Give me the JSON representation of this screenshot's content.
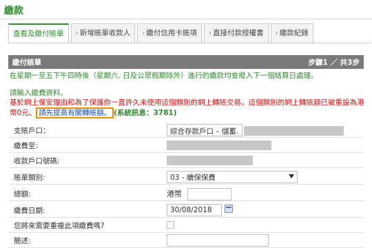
{
  "header": {
    "title": "繳款"
  },
  "tabs": [
    {
      "label": "查看及繳付賬單"
    },
    {
      "label": "新增賬單收款人"
    },
    {
      "label": "繳付信用卡賬項"
    },
    {
      "label": "直接付款授權書"
    },
    {
      "label": "繳款紀錄"
    }
  ],
  "band": {
    "left": "繳付賬單",
    "right": "步驟1 ／ 共3步"
  },
  "notice": "在星期一至五下午四時後（星期六, 日及公眾假期除外）進行的繳款均會撥入下一個結算日處理。",
  "prompt": "請輸入繳費資料。",
  "warning": {
    "text": "基於網上保安理由和為了保護你一直許久未使用這個類別的網上轉賬交易，這個類別的網上轉賬額已被重設為港幣0元。",
    "highlight": "請先提高有關轉賬額。",
    "system": "(系統訊息：3781)"
  },
  "form": {
    "source_account": {
      "label": "支賬戶口：",
      "value": "綜合存款戶口 – 儲蓄."
    },
    "pay_to": {
      "label": "繳費至:"
    },
    "payee_account": {
      "label": "收款戶口號碼:"
    },
    "bill_type": {
      "label": "賬單類別:",
      "value": "03 - 續保保費"
    },
    "amount": {
      "label": "總額:",
      "currency": "港幣"
    },
    "pay_date": {
      "label": "繳費日期:",
      "value": "30/08/2018"
    },
    "repeat": {
      "label": "您將來需要重複此項繳費嗎?"
    },
    "description": {
      "label": "簡述:"
    }
  }
}
